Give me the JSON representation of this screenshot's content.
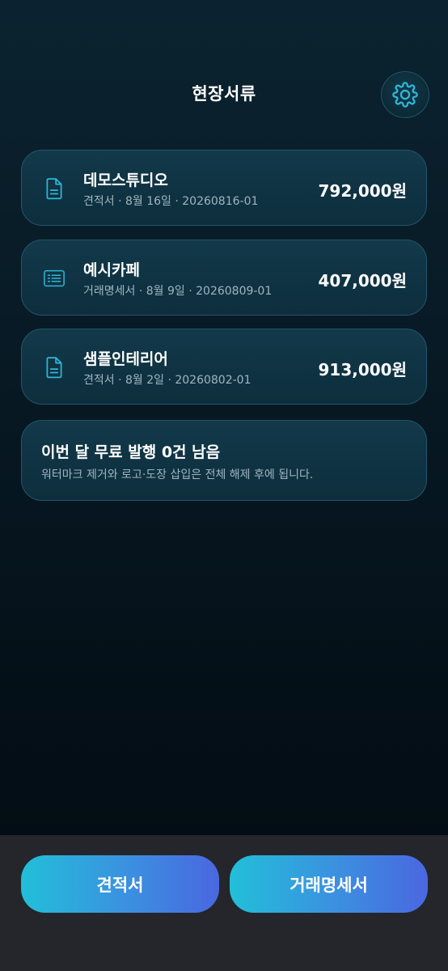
{
  "header": {
    "title": "현장서류",
    "settings_icon": "gear-icon"
  },
  "documents": [
    {
      "icon": "document-icon",
      "name": "데모스튜디오",
      "meta": "견적서 · 8월 16일 · 20260816-01",
      "amount": "792,000원"
    },
    {
      "icon": "receipt-list-icon",
      "name": "예시카페",
      "meta": "거래명세서 · 8월 9일 · 20260809-01",
      "amount": "407,000원"
    },
    {
      "icon": "document-icon",
      "name": "샘플인테리어",
      "meta": "견적서 · 8월 2일 · 20260802-01",
      "amount": "913,000원"
    }
  ],
  "notice": {
    "title": "이번 달 무료 발행 0건 남음",
    "subtitle": "워터마크 제거와 로고·도장 삽입은 전체 해제 후에 됩니다."
  },
  "actions": {
    "quote_label": "견적서",
    "statement_label": "거래명세서"
  },
  "colors": {
    "accent_cyan": "#22bfd9",
    "accent_blue": "#4a67e0",
    "icon_cyan": "#2fb8d8",
    "card_bg": "#12394a",
    "bottom_bar": "#24262b"
  }
}
